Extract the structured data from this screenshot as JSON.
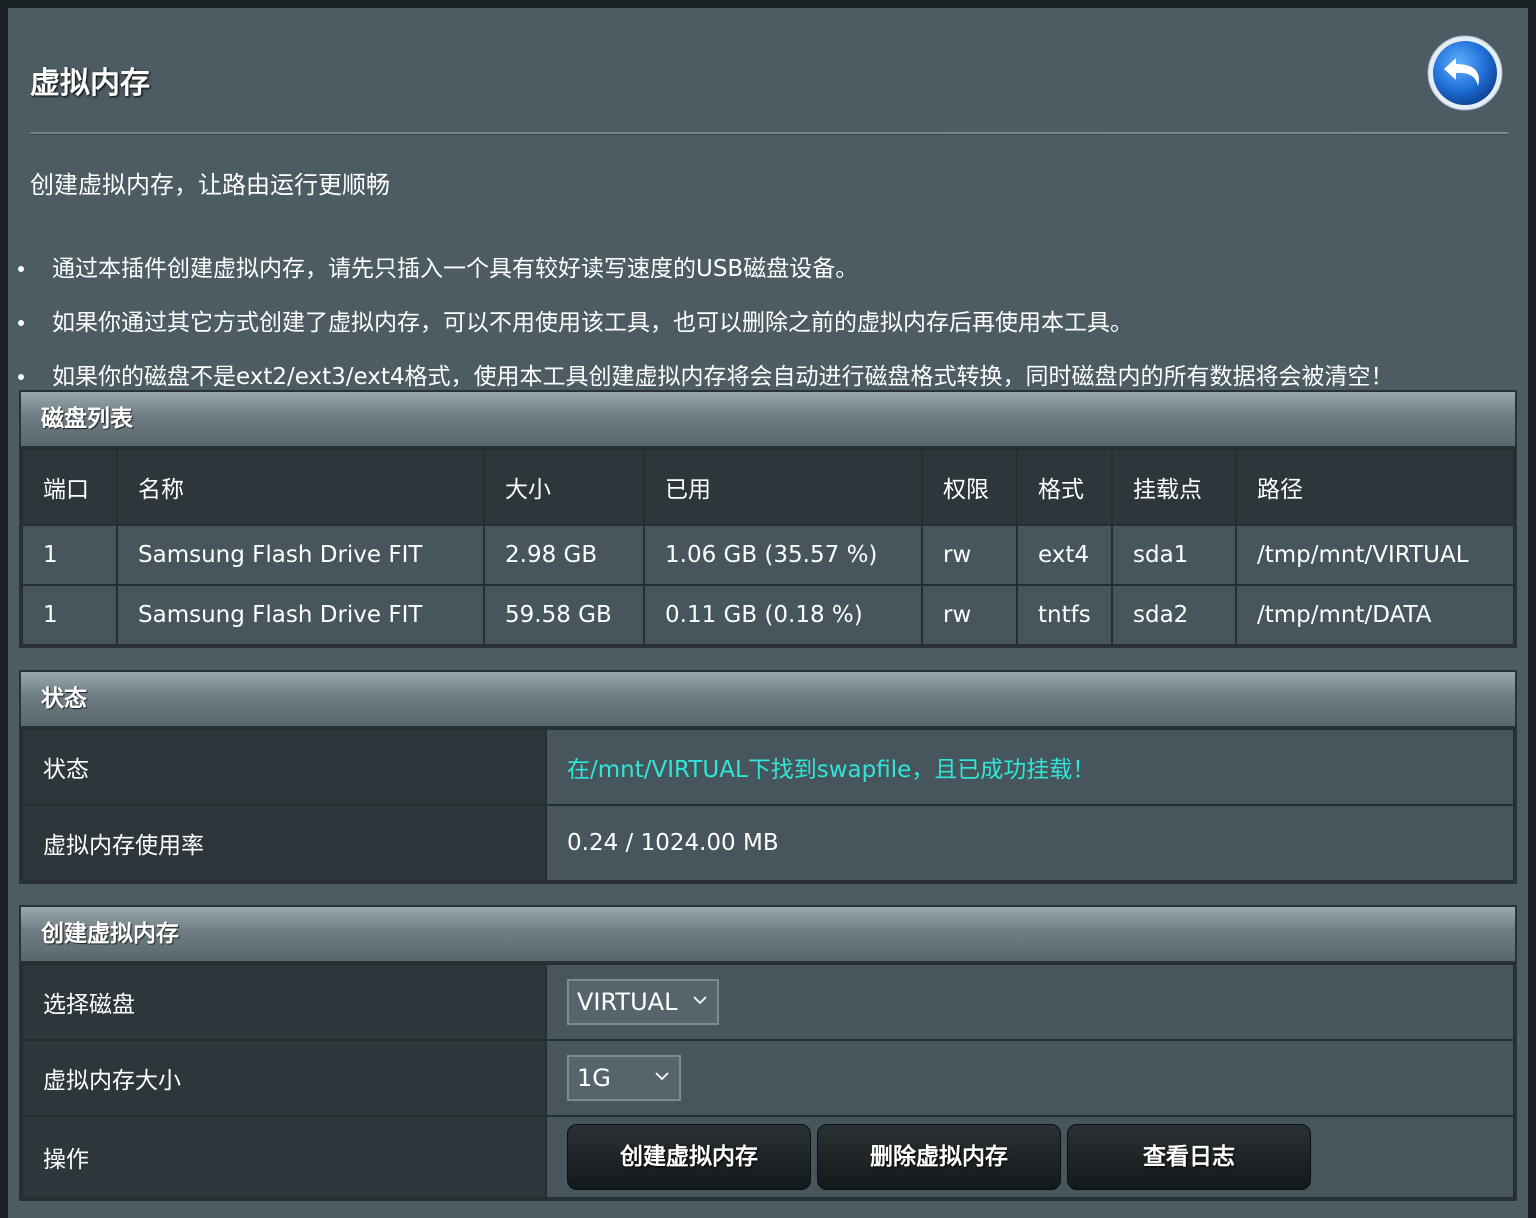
{
  "page": {
    "title": "虚拟内存",
    "subtitle": "创建虚拟内存，让路由运行更顺畅",
    "notes": [
      "通过本插件创建虚拟内存，请先只插入一个具有较好读写速度的USB磁盘设备。",
      "如果你通过其它方式创建了虚拟内存，可以不用使用该工具，也可以删除之前的虚拟内存后再使用本工具。",
      "如果你的磁盘不是ext2/ext3/ext4格式，使用本工具创建虚拟内存将会自动进行磁盘格式转换，同时磁盘内的所有数据将会被清空！"
    ]
  },
  "disk_list": {
    "header": "磁盘列表",
    "columns": [
      "端口",
      "名称",
      "大小",
      "已用",
      "权限",
      "格式",
      "挂载点",
      "路径"
    ],
    "rows": [
      [
        "1",
        "Samsung Flash Drive FIT",
        "2.98 GB",
        "1.06 GB (35.57 %)",
        "rw",
        "ext4",
        "sda1",
        "/tmp/mnt/VIRTUAL"
      ],
      [
        "1",
        "Samsung Flash Drive FIT",
        "59.58 GB",
        "0.11 GB (0.18 %)",
        "rw",
        "tntfs",
        "sda2",
        "/tmp/mnt/DATA"
      ]
    ]
  },
  "status": {
    "header": "状态",
    "status_label": "状态",
    "status_value": "在/mnt/VIRTUAL下找到swapfile，且已成功挂载！",
    "status_color": "#2fe6d9",
    "usage_label": "虚拟内存使用率",
    "usage_value": "0.24 / 1024.00 MB"
  },
  "create": {
    "header": "创建虚拟内存",
    "disk_label": "选择磁盘",
    "disk_selected": "VIRTUAL",
    "size_label": "虚拟内存大小",
    "size_selected": "1G",
    "action_label": "操作",
    "buttons": {
      "create": "创建虚拟内存",
      "delete": "删除虚拟内存",
      "log": "查看日志"
    }
  },
  "icons": {
    "back": "back-arrow-icon",
    "dropdown": "chevron-down-icon"
  }
}
